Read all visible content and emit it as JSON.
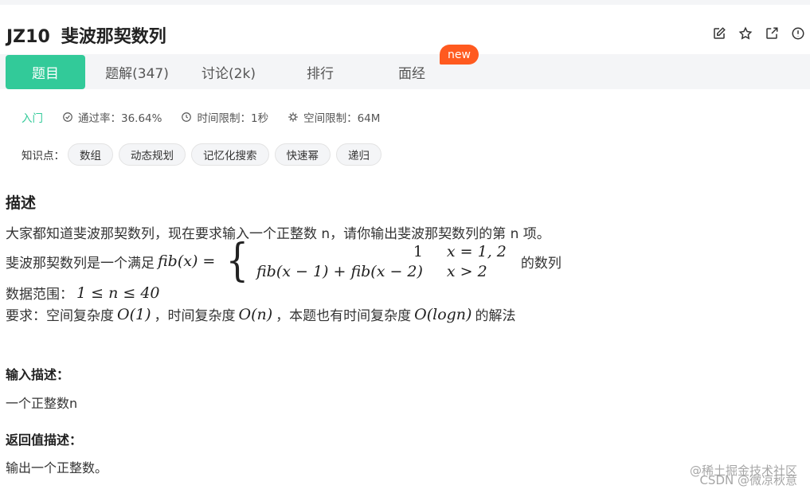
{
  "problem": {
    "id": "JZ10",
    "name": "斐波那契数列"
  },
  "toolbar": {
    "icons": [
      "edit-icon",
      "star-icon",
      "share-icon",
      "report-icon"
    ]
  },
  "tabs": [
    {
      "label": "题目",
      "active": true
    },
    {
      "label": "题解(347)",
      "active": false
    },
    {
      "label": "讨论(2k)",
      "active": false
    },
    {
      "label": "排行",
      "active": false
    },
    {
      "label": "面经",
      "active": false
    }
  ],
  "new_badge": "new",
  "meta": {
    "level": "入门",
    "pass_rate": "通过率：36.64%",
    "time_limit": "时间限制：1秒",
    "space_limit": "空间限制：64M"
  },
  "knowledge": {
    "label": "知识点：",
    "tags": [
      "数组",
      "动态规划",
      "记忆化搜索",
      "快速幂",
      "递归"
    ]
  },
  "description": {
    "title": "描述",
    "line1": "大家都知道斐波那契数列，现在要求输入一个正整数 n，请你输出斐波那契数列的第 n 项。",
    "line2_prefix": "斐波那契数列是一个满足",
    "line2_lhs": "fib(x) =",
    "case1_value": "1",
    "case1_cond": "x = 1, 2",
    "case2_value": "fib(x − 1) + fib(x − 2)",
    "case2_cond": "x > 2",
    "line2_suffix": "的数列",
    "range_prefix": "数据范围：",
    "range_math": "1 ≤ n ≤ 40",
    "req_prefix": "要求：空间复杂度",
    "req_space": "O(1)",
    "req_mid": "，时间复杂度",
    "req_time": "O(n)",
    "req_mid2": "，本题也有时间复杂度",
    "req_alt": "O(logn)",
    "req_suffix": "的解法"
  },
  "input": {
    "title": "输入描述：",
    "text": "一个正整数n"
  },
  "output": {
    "title": "返回值描述：",
    "text": "输出一个正整数。"
  },
  "watermarks": [
    "@稀土掘金技术社区",
    "CSDN @微凉秋意"
  ]
}
